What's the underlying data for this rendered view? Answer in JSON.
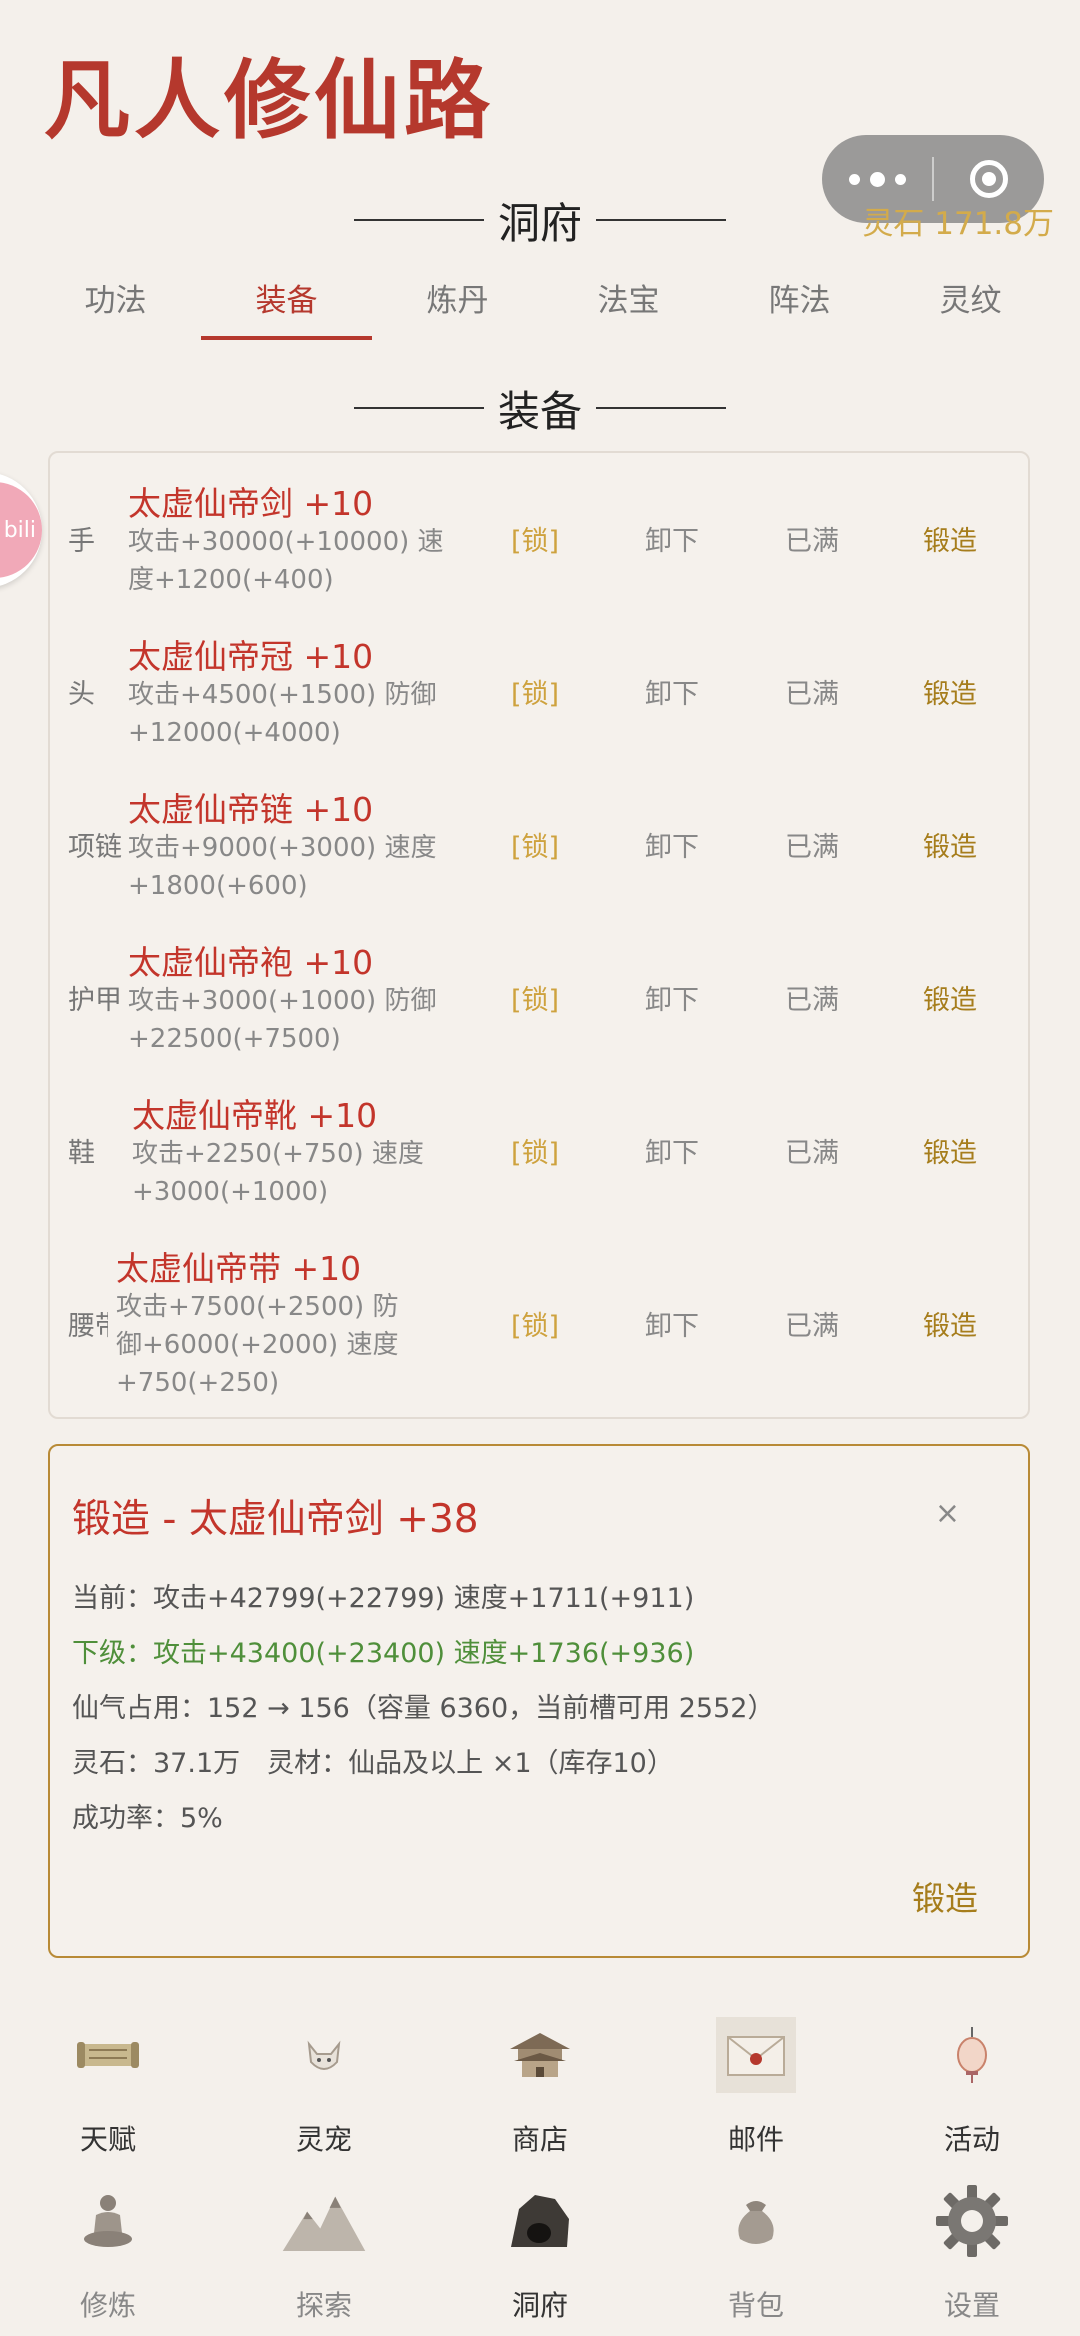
{
  "app": {
    "title": "凡人修仙路"
  },
  "header": {
    "spirit_stone": "灵石 171.8万"
  },
  "cave": {
    "heading": "洞府"
  },
  "tabs": [
    {
      "label": "功法"
    },
    {
      "label": "装备"
    },
    {
      "label": "炼丹"
    },
    {
      "label": "法宝"
    },
    {
      "label": "阵法"
    },
    {
      "label": "灵纹"
    }
  ],
  "equipment": {
    "heading": "装备",
    "rows": [
      {
        "slot": "手",
        "name": "太虚仙帝剑 +10",
        "desc": "攻击+30000(+10000) 速度+1200(+400)",
        "lock": "[锁]",
        "unequip": "卸下",
        "status": "已满",
        "forge": "锻造"
      },
      {
        "slot": "头",
        "name": "太虚仙帝冠 +10",
        "desc": "攻击+4500(+1500) 防御+12000(+4000)",
        "lock": "[锁]",
        "unequip": "卸下",
        "status": "已满",
        "forge": "锻造"
      },
      {
        "slot": "项链",
        "name": "太虚仙帝链 +10",
        "desc": "攻击+9000(+3000) 速度+1800(+600)",
        "lock": "[锁]",
        "unequip": "卸下",
        "status": "已满",
        "forge": "锻造"
      },
      {
        "slot": "护甲",
        "name": "太虚仙帝袍 +10",
        "desc": "攻击+3000(+1000) 防御+22500(+7500)",
        "lock": "[锁]",
        "unequip": "卸下",
        "status": "已满",
        "forge": "锻造"
      },
      {
        "slot": "鞋",
        "name": "太虚仙帝靴 +10",
        "desc": "攻击+2250(+750) 速度+3000(+1000)",
        "lock": "[锁]",
        "unequip": "卸下",
        "status": "已满",
        "forge": "锻造"
      },
      {
        "slot": "腰带",
        "name": "太虚仙帝带 +10",
        "desc": "攻击+7500(+2500) 防御+6000(+2000) 速度+750(+250)",
        "lock": "[锁]",
        "unequip": "卸下",
        "status": "已满",
        "forge": "锻造"
      }
    ]
  },
  "forge": {
    "title": "锻造 - 太虚仙帝剑 +38",
    "close": "×",
    "current": "当前：攻击+42799(+22799) 速度+1711(+911)",
    "next": "下级：攻击+43400(+23400) 速度+1736(+936)",
    "qi": "仙气占用：152 → 156（容量 6360，当前槽可用 2552）",
    "cost": "灵石：37.1万　灵材：仙品及以上 ×1（库存10）",
    "rate": "成功率：5%",
    "button": "锻造"
  },
  "badge": {
    "text": "bili"
  },
  "nav_top": [
    {
      "label": "天赋",
      "icon": "scroll-icon"
    },
    {
      "label": "灵宠",
      "icon": "fox-icon"
    },
    {
      "label": "商店",
      "icon": "pavilion-icon"
    },
    {
      "label": "邮件",
      "icon": "envelope-icon"
    },
    {
      "label": "活动",
      "icon": "lantern-icon"
    }
  ],
  "nav_bottom": [
    {
      "label": "修炼",
      "icon": "meditation-icon"
    },
    {
      "label": "探索",
      "icon": "mountain-icon"
    },
    {
      "label": "洞府",
      "icon": "cave-icon"
    },
    {
      "label": "背包",
      "icon": "bag-icon"
    },
    {
      "label": "设置",
      "icon": "gear-icon"
    }
  ]
}
